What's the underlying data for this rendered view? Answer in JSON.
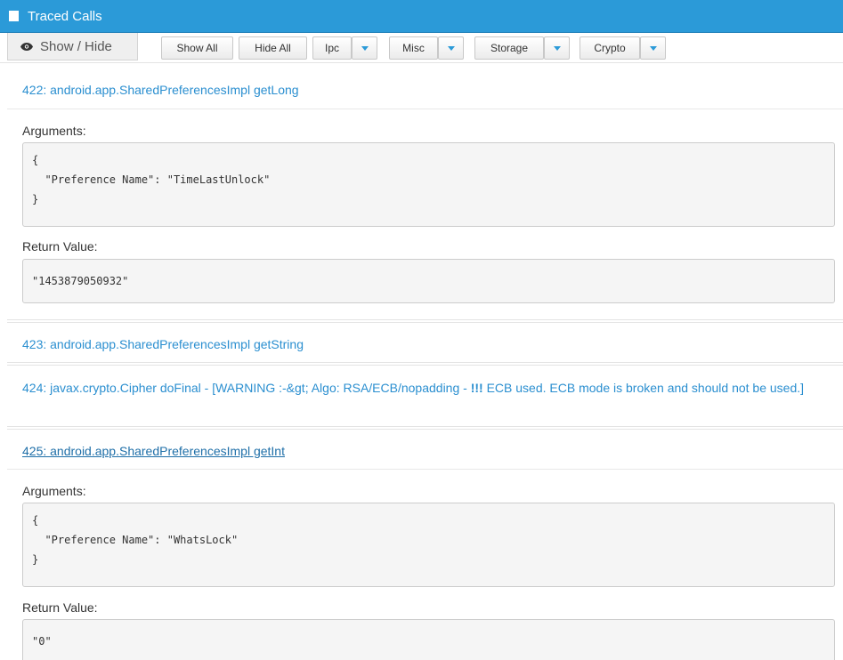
{
  "window": {
    "title": "Traced Calls"
  },
  "toolbar": {
    "show_hide": "Show / Hide",
    "show_all": "Show All",
    "hide_all": "Hide All",
    "filters": [
      "Ipc",
      "Misc",
      "Storage",
      "Crypto"
    ]
  },
  "calls": [
    {
      "title": "422: android.app.SharedPreferencesImpl getLong",
      "arguments_label": "Arguments:",
      "arguments_lines": [
        "{",
        "  \"Preference Name\": \"TimeLastUnlock\"",
        "}"
      ],
      "return_label": "Return Value:",
      "return_value": "\"1453879050932\""
    },
    {
      "title": "423: android.app.SharedPreferencesImpl getString"
    },
    {
      "title_prefix": "424: javax.crypto.Cipher doFinal - [WARNING :-&gt; Algo: RSA/ECB/nopadding - ",
      "title_bold": "!!!",
      "title_suffix": " ECB used. ECB mode is broken and should not be used.]"
    },
    {
      "title": "425: android.app.SharedPreferencesImpl getInt",
      "arguments_label": "Arguments:",
      "arguments_lines": [
        "{",
        "  \"Preference Name\": \"WhatsLock\"",
        "}"
      ],
      "return_label": "Return Value:",
      "return_value": "\"0\""
    }
  ],
  "colors": {
    "titlebar": "#2b9ad8",
    "link": "#2b8fd0"
  },
  "icons": {
    "title": "square-icon",
    "show_hide": "eye-icon",
    "dropdown": "caret-down-icon"
  }
}
